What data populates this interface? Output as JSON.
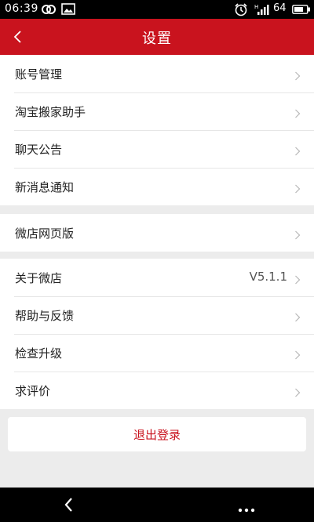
{
  "status_bar": {
    "time": "06:39",
    "battery": "64",
    "icons": [
      "link-icon",
      "image-icon",
      "alarm-icon",
      "signal-icon",
      "battery-icon"
    ]
  },
  "header": {
    "title": "设置",
    "back_icon": "chevron-left-icon",
    "color": "#c9131e"
  },
  "groups": [
    {
      "items": [
        {
          "label": "账号管理"
        },
        {
          "label": "淘宝搬家助手"
        },
        {
          "label": "聊天公告"
        },
        {
          "label": "新消息通知"
        }
      ]
    },
    {
      "items": [
        {
          "label": "微店网页版"
        }
      ]
    },
    {
      "items": [
        {
          "label": "关于微店",
          "value": "V5.1.1"
        },
        {
          "label": "帮助与反馈"
        },
        {
          "label": "检查升级"
        },
        {
          "label": "求评价"
        }
      ]
    }
  ],
  "logout": {
    "label": "退出登录"
  },
  "nav_bar": {
    "back_icon": "back-arrow-icon",
    "menu_icon": "more-dots-icon"
  }
}
